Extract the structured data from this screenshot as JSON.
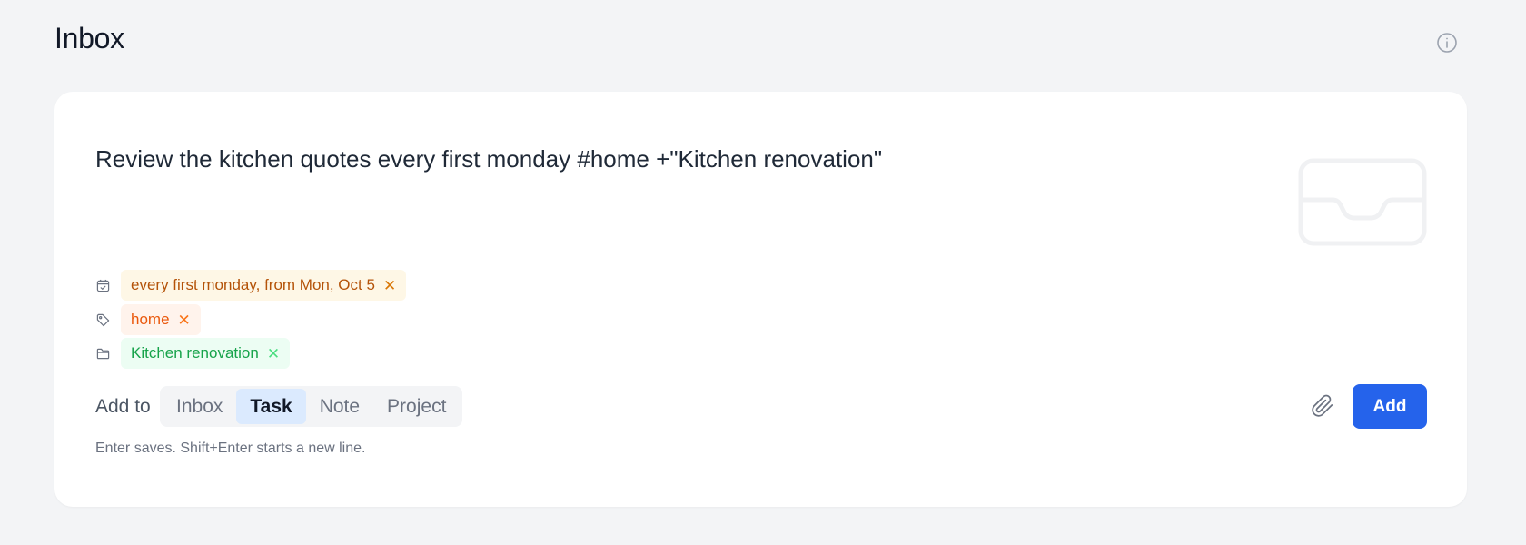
{
  "header": {
    "title": "Inbox",
    "info_icon": "info-circle-icon"
  },
  "composer": {
    "input_text": "Review the kitchen quotes every first monday #home +\"Kitchen renovation\"",
    "illustration": "inbox-tray-icon",
    "chips": {
      "schedule": {
        "icon": "calendar-icon",
        "label": "every first monday, from Mon, Oct 5",
        "remove_icon": "close-icon"
      },
      "tag": {
        "icon": "tag-icon",
        "label": "home",
        "remove_icon": "close-icon"
      },
      "project": {
        "icon": "folder-icon",
        "label": "Kitchen renovation",
        "remove_icon": "close-icon"
      }
    },
    "add_to": {
      "label": "Add to",
      "options": [
        "Inbox",
        "Task",
        "Note",
        "Project"
      ],
      "selected": "Task"
    },
    "attach_icon": "paperclip-icon",
    "add_button": "Add",
    "hint": "Enter saves. Shift+Enter starts a new line."
  },
  "colors": {
    "accent": "#2563eb",
    "schedule_chip_text": "#b45309",
    "tag_chip_text": "#ea580c",
    "project_chip_text": "#16a34a",
    "selected_option_bg": "#dbeafe"
  }
}
